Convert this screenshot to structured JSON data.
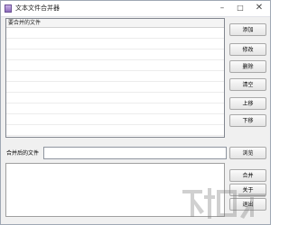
{
  "window": {
    "title": "文本文件合并器",
    "icon": "app-icon",
    "controls": {
      "minimize": "–",
      "maximize": "□",
      "close": "✕"
    }
  },
  "file_list": {
    "column_header": "要合并的文件",
    "items": []
  },
  "buttons": {
    "add": "添加",
    "edit": "修改",
    "delete": "删除",
    "clear": "清空",
    "move_up": "上移",
    "move_down": "下移",
    "browse": "浏览",
    "merge": "合并",
    "about": "关于",
    "exit": "退出"
  },
  "output": {
    "label": "合并后的文件",
    "value": "",
    "placeholder": ""
  },
  "log": {
    "text": ""
  }
}
